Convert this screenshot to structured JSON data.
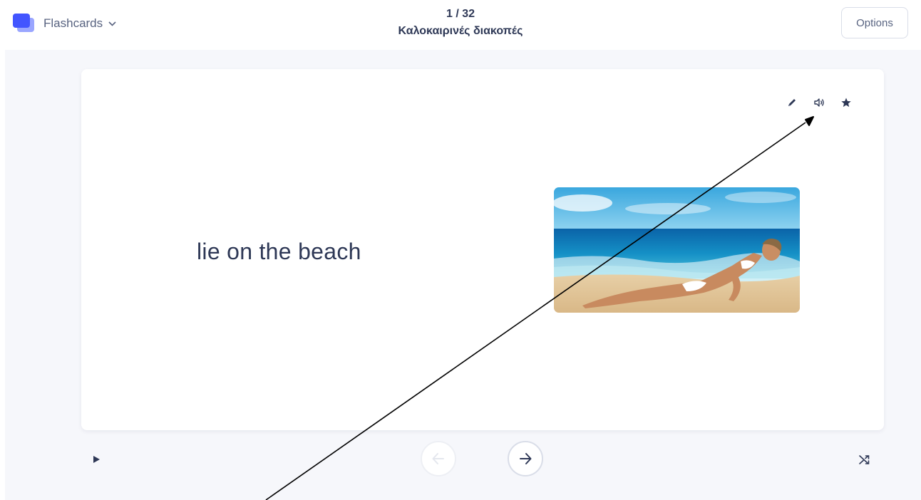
{
  "header": {
    "mode_label": "Flashcards",
    "mode_icon": "flashcards-logo-icon",
    "progress": "1 / 32",
    "set_title": "Καλοκαιρινές διακοπές",
    "options_label": "Options"
  },
  "card": {
    "term": "lie on the beach",
    "image_subject": "woman-lying-on-beach-image",
    "icons": [
      "edit-icon",
      "audio-icon",
      "star-icon"
    ]
  },
  "controls": {
    "icons": [
      "play-icon",
      "previous-arrow-icon",
      "next-arrow-icon",
      "shuffle-icon"
    ]
  },
  "colors": {
    "brand": "#4255ff",
    "text": "#2e3856",
    "muted": "#586380",
    "stage_bg": "#f6f7fb"
  }
}
